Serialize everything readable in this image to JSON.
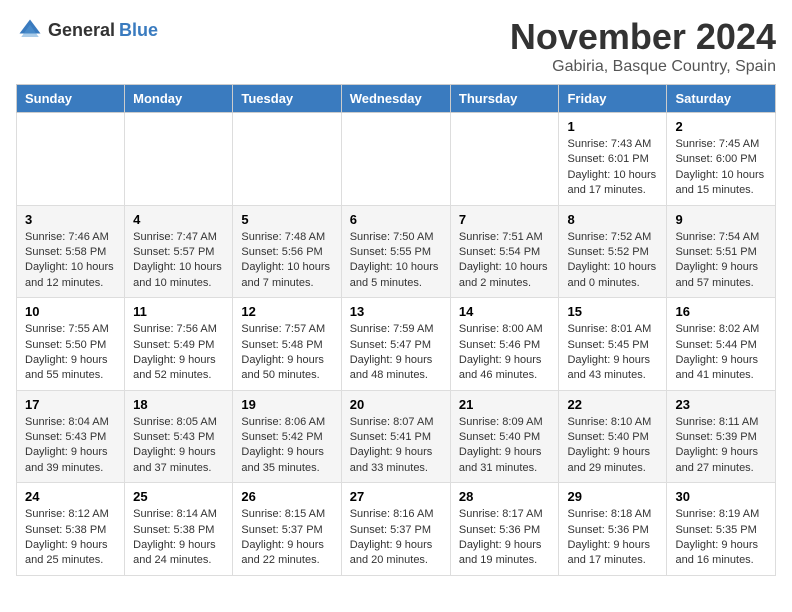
{
  "header": {
    "logo_general": "General",
    "logo_blue": "Blue",
    "month": "November 2024",
    "location": "Gabiria, Basque Country, Spain"
  },
  "weekdays": [
    "Sunday",
    "Monday",
    "Tuesday",
    "Wednesday",
    "Thursday",
    "Friday",
    "Saturday"
  ],
  "weeks": [
    [
      {
        "day": "",
        "info": ""
      },
      {
        "day": "",
        "info": ""
      },
      {
        "day": "",
        "info": ""
      },
      {
        "day": "",
        "info": ""
      },
      {
        "day": "",
        "info": ""
      },
      {
        "day": "1",
        "info": "Sunrise: 7:43 AM\nSunset: 6:01 PM\nDaylight: 10 hours and 17 minutes."
      },
      {
        "day": "2",
        "info": "Sunrise: 7:45 AM\nSunset: 6:00 PM\nDaylight: 10 hours and 15 minutes."
      }
    ],
    [
      {
        "day": "3",
        "info": "Sunrise: 7:46 AM\nSunset: 5:58 PM\nDaylight: 10 hours and 12 minutes."
      },
      {
        "day": "4",
        "info": "Sunrise: 7:47 AM\nSunset: 5:57 PM\nDaylight: 10 hours and 10 minutes."
      },
      {
        "day": "5",
        "info": "Sunrise: 7:48 AM\nSunset: 5:56 PM\nDaylight: 10 hours and 7 minutes."
      },
      {
        "day": "6",
        "info": "Sunrise: 7:50 AM\nSunset: 5:55 PM\nDaylight: 10 hours and 5 minutes."
      },
      {
        "day": "7",
        "info": "Sunrise: 7:51 AM\nSunset: 5:54 PM\nDaylight: 10 hours and 2 minutes."
      },
      {
        "day": "8",
        "info": "Sunrise: 7:52 AM\nSunset: 5:52 PM\nDaylight: 10 hours and 0 minutes."
      },
      {
        "day": "9",
        "info": "Sunrise: 7:54 AM\nSunset: 5:51 PM\nDaylight: 9 hours and 57 minutes."
      }
    ],
    [
      {
        "day": "10",
        "info": "Sunrise: 7:55 AM\nSunset: 5:50 PM\nDaylight: 9 hours and 55 minutes."
      },
      {
        "day": "11",
        "info": "Sunrise: 7:56 AM\nSunset: 5:49 PM\nDaylight: 9 hours and 52 minutes."
      },
      {
        "day": "12",
        "info": "Sunrise: 7:57 AM\nSunset: 5:48 PM\nDaylight: 9 hours and 50 minutes."
      },
      {
        "day": "13",
        "info": "Sunrise: 7:59 AM\nSunset: 5:47 PM\nDaylight: 9 hours and 48 minutes."
      },
      {
        "day": "14",
        "info": "Sunrise: 8:00 AM\nSunset: 5:46 PM\nDaylight: 9 hours and 46 minutes."
      },
      {
        "day": "15",
        "info": "Sunrise: 8:01 AM\nSunset: 5:45 PM\nDaylight: 9 hours and 43 minutes."
      },
      {
        "day": "16",
        "info": "Sunrise: 8:02 AM\nSunset: 5:44 PM\nDaylight: 9 hours and 41 minutes."
      }
    ],
    [
      {
        "day": "17",
        "info": "Sunrise: 8:04 AM\nSunset: 5:43 PM\nDaylight: 9 hours and 39 minutes."
      },
      {
        "day": "18",
        "info": "Sunrise: 8:05 AM\nSunset: 5:43 PM\nDaylight: 9 hours and 37 minutes."
      },
      {
        "day": "19",
        "info": "Sunrise: 8:06 AM\nSunset: 5:42 PM\nDaylight: 9 hours and 35 minutes."
      },
      {
        "day": "20",
        "info": "Sunrise: 8:07 AM\nSunset: 5:41 PM\nDaylight: 9 hours and 33 minutes."
      },
      {
        "day": "21",
        "info": "Sunrise: 8:09 AM\nSunset: 5:40 PM\nDaylight: 9 hours and 31 minutes."
      },
      {
        "day": "22",
        "info": "Sunrise: 8:10 AM\nSunset: 5:40 PM\nDaylight: 9 hours and 29 minutes."
      },
      {
        "day": "23",
        "info": "Sunrise: 8:11 AM\nSunset: 5:39 PM\nDaylight: 9 hours and 27 minutes."
      }
    ],
    [
      {
        "day": "24",
        "info": "Sunrise: 8:12 AM\nSunset: 5:38 PM\nDaylight: 9 hours and 25 minutes."
      },
      {
        "day": "25",
        "info": "Sunrise: 8:14 AM\nSunset: 5:38 PM\nDaylight: 9 hours and 24 minutes."
      },
      {
        "day": "26",
        "info": "Sunrise: 8:15 AM\nSunset: 5:37 PM\nDaylight: 9 hours and 22 minutes."
      },
      {
        "day": "27",
        "info": "Sunrise: 8:16 AM\nSunset: 5:37 PM\nDaylight: 9 hours and 20 minutes."
      },
      {
        "day": "28",
        "info": "Sunrise: 8:17 AM\nSunset: 5:36 PM\nDaylight: 9 hours and 19 minutes."
      },
      {
        "day": "29",
        "info": "Sunrise: 8:18 AM\nSunset: 5:36 PM\nDaylight: 9 hours and 17 minutes."
      },
      {
        "day": "30",
        "info": "Sunrise: 8:19 AM\nSunset: 5:35 PM\nDaylight: 9 hours and 16 minutes."
      }
    ]
  ]
}
